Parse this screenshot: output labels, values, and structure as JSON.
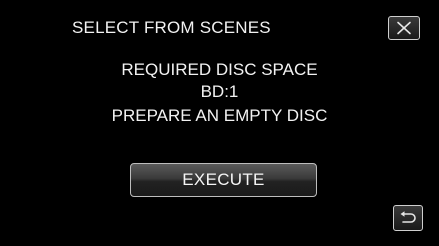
{
  "header": {
    "title": "SELECT FROM SCENES",
    "close_icon": "close-icon"
  },
  "message": {
    "line1": "REQUIRED DISC SPACE",
    "line2": "BD:1",
    "line3": "PREPARE AN EMPTY DISC"
  },
  "actions": {
    "execute_label": "EXECUTE",
    "back_icon": "return-arrow-icon"
  },
  "colors": {
    "background": "#000000",
    "text": "#f2f2f2",
    "button_border": "#cfcfcf"
  }
}
